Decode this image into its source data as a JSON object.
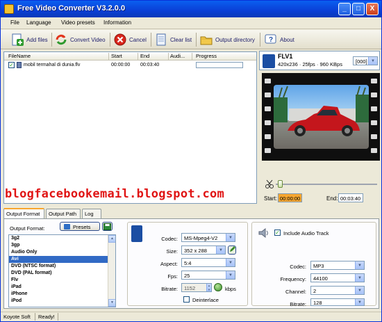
{
  "window": {
    "title": "Free Video Converter V3.2.0.0",
    "minimize": "_",
    "maximize": "□",
    "close": "X"
  },
  "menu": [
    "File",
    "Language",
    "Video presets",
    "Information"
  ],
  "toolbar": {
    "add_files": "Add files",
    "convert_video": "Convert Video",
    "cancel": "Cancel",
    "clear_list": "Clear list",
    "output_directory": "Output directory",
    "about": "About"
  },
  "file_list": {
    "columns": [
      "FileName",
      "Start",
      "End",
      "Audi...",
      "Progress"
    ],
    "rows": [
      {
        "checked": true,
        "name": "mobil termahal di dunia.flv",
        "start": "00:00:00",
        "end": "00:03:40",
        "audio": ""
      }
    ]
  },
  "watermark": "blogfacebookemail.blogspot.com",
  "source_info": {
    "format": "FLV1",
    "details": "420x236 · 25fps · 960 KBps",
    "stream_select": "[000]"
  },
  "trim": {
    "start_label": "Start:",
    "start_value": "00:00:00",
    "end_label": "End:",
    "end_value": "00:03:40",
    "position": 0.02
  },
  "tabs": [
    "Output Format",
    "Output Path",
    "Log"
  ],
  "output_format": {
    "label": "Output Format:",
    "presets_button": "Presets",
    "formats": [
      "3g2",
      "3gp",
      "Audio Only",
      "Avi",
      "DVD (NTSC format)",
      "DVD (PAL format)",
      "Flv",
      "iPad",
      "iPhone",
      "iPod"
    ],
    "selected_index": 3
  },
  "video": {
    "codec_label": "Codec:",
    "codec": "MS-Mpeg4-V2",
    "size_label": "Size:",
    "size": "352 x 288",
    "aspect_label": "Aspect:",
    "aspect": "5:4",
    "fps_label": "Fps:",
    "fps": "25",
    "bitrate_label": "Bitrate:",
    "bitrate": "1152",
    "bitrate_unit": "kbps",
    "deinterlace_label": "Deinterlace"
  },
  "audio": {
    "include_label": "Include Audio Track",
    "codec_label": "Codec:",
    "codec": "MP3",
    "frequency_label": "Frequency:",
    "frequency": "44100",
    "channel_label": "Channel:",
    "channel": "2",
    "bitrate_label": "Bitrate:",
    "bitrate": "128"
  },
  "status": {
    "company": "Koyote Soft",
    "message": "Ready!"
  },
  "colors": {
    "title_bar": "#0a3fd6",
    "watermark": "#e01414",
    "selection": "#316ac5",
    "time_highlight": "#f7a630"
  }
}
